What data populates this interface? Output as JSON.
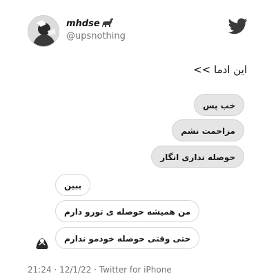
{
  "author": {
    "display_name": "mhdse",
    "handle": "@upsnothing",
    "avatar_icon": "profile-photo",
    "name_emoji_icon": "sauropod-dinosaur-icon"
  },
  "platform_icon": "twitter-bird-icon",
  "tweet": {
    "text": "این ادما >>"
  },
  "chat": {
    "sent_messages": [
      "خب پس",
      "مزاحمت نشم",
      "حوصله نداری انگار"
    ],
    "received_messages": [
      "ببین",
      "من همیشه حوصله ی تورو دارم",
      "حتی وقتی حوصله خودمو ندارم"
    ],
    "sent_bubble_color": "#e5e5e5",
    "received_bubble_color": "#ffffff"
  },
  "meta": {
    "time": "21:24",
    "date": "12/1/22",
    "source": "Twitter for iPhone",
    "separator": "·"
  }
}
